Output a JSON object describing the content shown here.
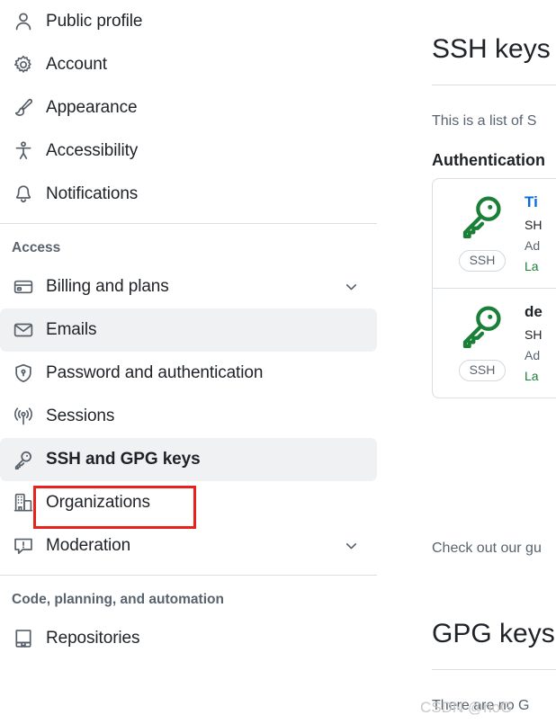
{
  "sidebar": {
    "groups": [
      {
        "header": null,
        "items": [
          {
            "label": "Public profile",
            "icon": "person-icon",
            "selected": false,
            "chevron": false,
            "emphasis": false
          },
          {
            "label": "Account",
            "icon": "gear-icon",
            "selected": false,
            "chevron": false,
            "emphasis": false
          },
          {
            "label": "Appearance",
            "icon": "paintbrush-icon",
            "selected": false,
            "chevron": false,
            "emphasis": false
          },
          {
            "label": "Accessibility",
            "icon": "accessibility-icon",
            "selected": false,
            "chevron": false,
            "emphasis": false
          },
          {
            "label": "Notifications",
            "icon": "bell-icon",
            "selected": false,
            "chevron": false,
            "emphasis": false
          }
        ]
      },
      {
        "header": "Access",
        "items": [
          {
            "label": "Billing and plans",
            "icon": "creditcard-icon",
            "selected": false,
            "chevron": true,
            "emphasis": false
          },
          {
            "label": "Emails",
            "icon": "mail-icon",
            "selected": true,
            "chevron": false,
            "emphasis": false
          },
          {
            "label": "Password and authentication",
            "icon": "shield-lock-icon",
            "selected": false,
            "chevron": false,
            "emphasis": false
          },
          {
            "label": "Sessions",
            "icon": "broadcast-icon",
            "selected": false,
            "chevron": false,
            "emphasis": false
          },
          {
            "label": "SSH and GPG keys",
            "icon": "key-icon",
            "selected": true,
            "chevron": false,
            "emphasis": true
          },
          {
            "label": "Organizations",
            "icon": "organization-icon",
            "selected": false,
            "chevron": false,
            "emphasis": false
          },
          {
            "label": "Moderation",
            "icon": "report-icon",
            "selected": false,
            "chevron": true,
            "emphasis": false
          }
        ]
      },
      {
        "header": "Code, planning, and automation",
        "items": [
          {
            "label": "Repositories",
            "icon": "repo-icon",
            "selected": false,
            "chevron": false,
            "emphasis": false
          }
        ]
      }
    ]
  },
  "content": {
    "ssh_heading": "SSH keys",
    "ssh_description": "This is a list of S",
    "auth_keys_heading": "Authentication",
    "keys": [
      {
        "badge": "SSH",
        "title": "Ti",
        "fingerprint": "SH",
        "added": "Ad",
        "last_used": "La",
        "title_is_link": true
      },
      {
        "badge": "SSH",
        "title": "de",
        "fingerprint": "SH",
        "added": "Ad",
        "last_used": "La",
        "title_is_link": false
      }
    ],
    "guide_text": "Check out our gu",
    "gpg_heading": "GPG keys",
    "gpg_description": "There are no G"
  },
  "annotation": {
    "highlight_label": "SSH and GPG keys",
    "highlight_color": "#e8211c"
  },
  "watermark": {
    "text": "CSDN @noG"
  }
}
